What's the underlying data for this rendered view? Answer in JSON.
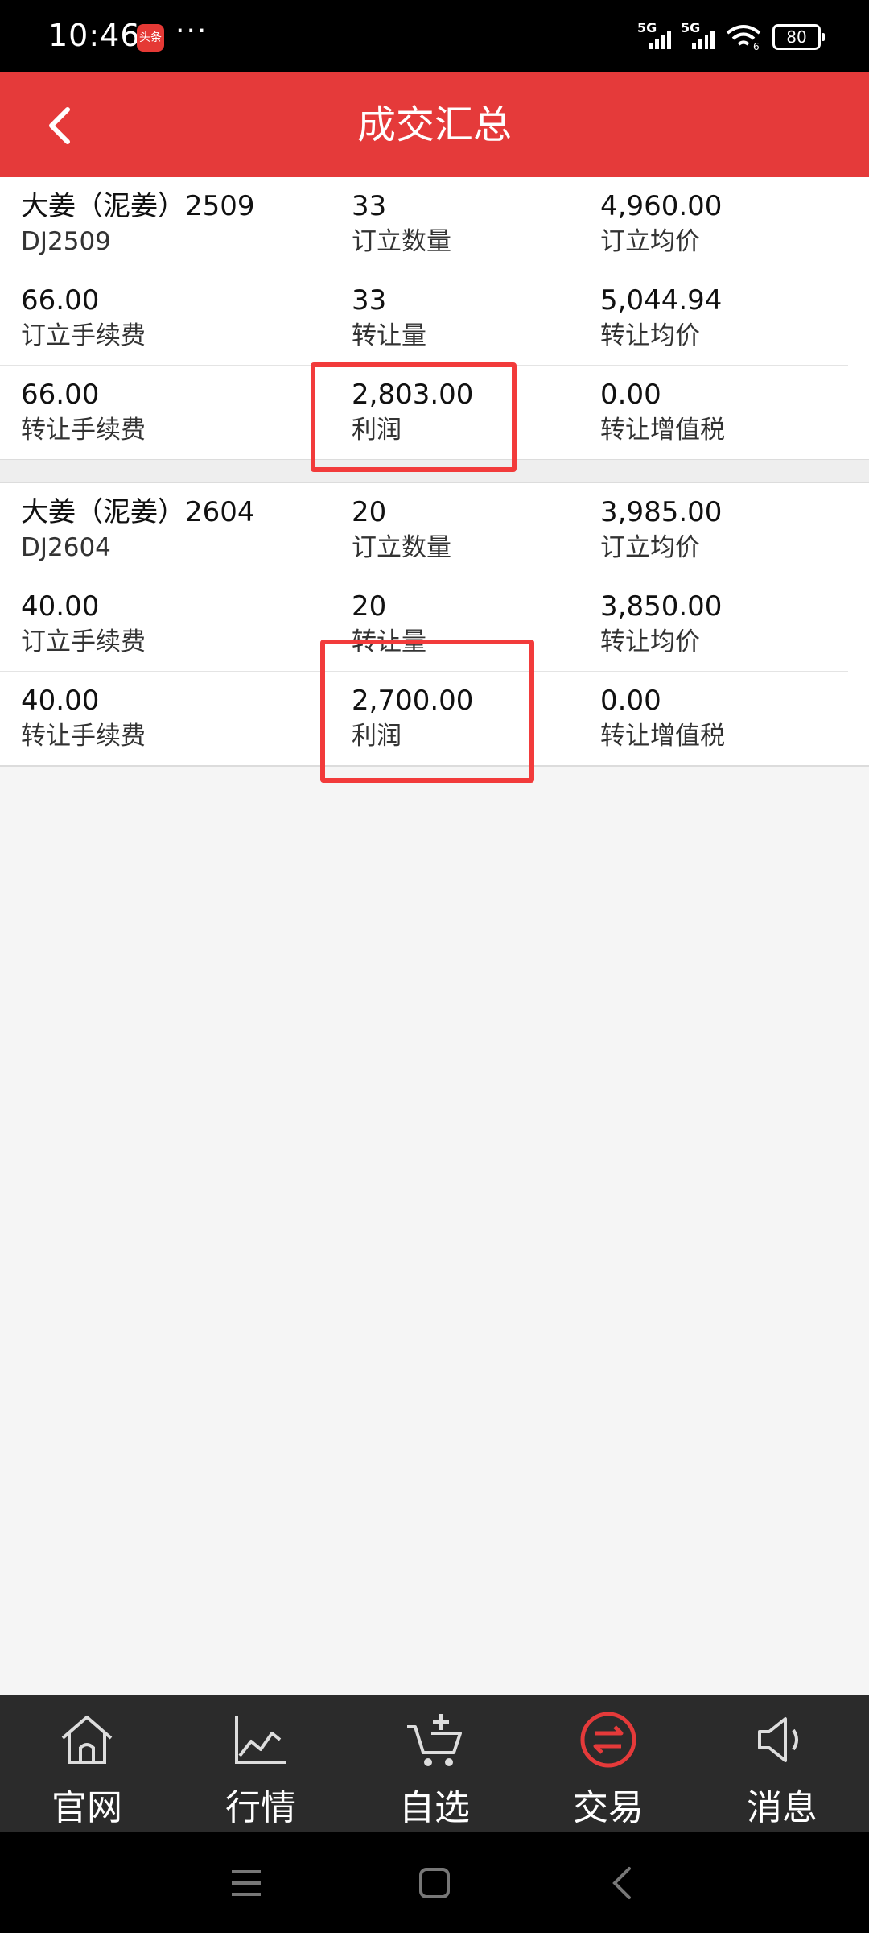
{
  "status_bar": {
    "time": "10:46",
    "app_icon_text": "头条",
    "dots": "···",
    "signal1": "5G",
    "signal2": "5G",
    "wifi_badge": "6",
    "battery": "80"
  },
  "header": {
    "title": "成交汇总"
  },
  "sections": [
    {
      "rows": [
        [
          {
            "value": "大姜（泥姜）2509",
            "label": "DJ2509"
          },
          {
            "value": "33",
            "label": "订立数量"
          },
          {
            "value": "4,960.00",
            "label": "订立均价"
          }
        ],
        [
          {
            "value": "66.00",
            "label": "订立手续费"
          },
          {
            "value": "33",
            "label": "转让量"
          },
          {
            "value": "5,044.94",
            "label": "转让均价"
          }
        ],
        [
          {
            "value": "66.00",
            "label": "转让手续费"
          },
          {
            "value": "2,803.00",
            "label": "利润"
          },
          {
            "value": "0.00",
            "label": "转让增值税"
          }
        ]
      ]
    },
    {
      "rows": [
        [
          {
            "value": "大姜（泥姜）2604",
            "label": "DJ2604"
          },
          {
            "value": "20",
            "label": "订立数量"
          },
          {
            "value": "3,985.00",
            "label": "订立均价"
          }
        ],
        [
          {
            "value": "40.00",
            "label": "订立手续费"
          },
          {
            "value": "20",
            "label": "转让量"
          },
          {
            "value": "3,850.00",
            "label": "转让均价"
          }
        ],
        [
          {
            "value": "40.00",
            "label": "转让手续费"
          },
          {
            "value": "2,700.00",
            "label": "利润"
          },
          {
            "value": "0.00",
            "label": "转让增值税"
          }
        ]
      ]
    }
  ],
  "tabbar": {
    "tabs": [
      {
        "label": "官网",
        "icon": "home-icon"
      },
      {
        "label": "行情",
        "icon": "chart-icon"
      },
      {
        "label": "自选",
        "icon": "cart-add-icon"
      },
      {
        "label": "交易",
        "icon": "exchange-icon",
        "active": true
      },
      {
        "label": "消息",
        "icon": "speaker-icon"
      }
    ],
    "active_color": "#e53a3a"
  },
  "colors": {
    "header_bg": "#e53a3a",
    "highlight": "#f23b3b"
  }
}
